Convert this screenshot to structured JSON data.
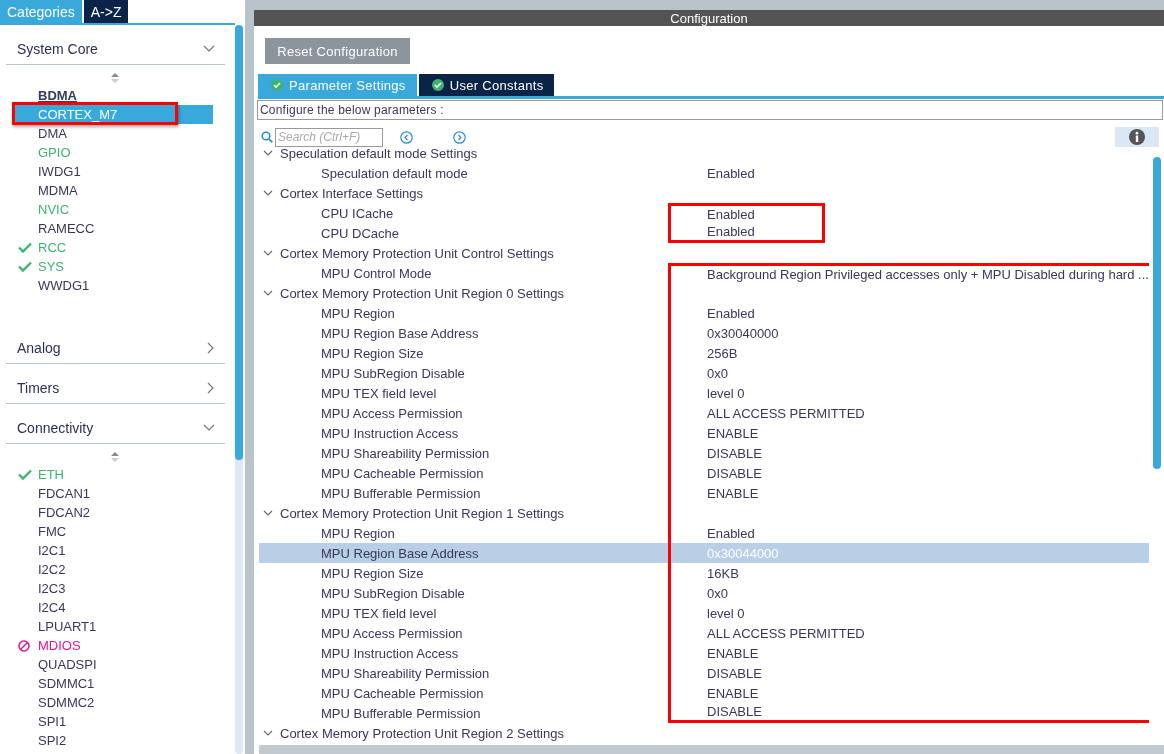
{
  "sidebar": {
    "tabs": [
      {
        "label": "Categories",
        "selected": true
      },
      {
        "label": "A->Z",
        "selected": false
      }
    ],
    "sections": [
      {
        "title": "System Core",
        "expanded": true,
        "items": [
          {
            "label": "BDMA",
            "kind": "emphasis",
            "selected": false,
            "marked": false
          },
          {
            "label": "CORTEX_M7",
            "kind": "plain",
            "selected": true,
            "marked": true
          },
          {
            "label": "DMA",
            "kind": "plain",
            "selected": false,
            "marked": false
          },
          {
            "label": "GPIO",
            "kind": "green",
            "selected": false,
            "marked": false
          },
          {
            "label": "IWDG1",
            "kind": "plain",
            "selected": false,
            "marked": false
          },
          {
            "label": "MDMA",
            "kind": "plain",
            "selected": false,
            "marked": false
          },
          {
            "label": "NVIC",
            "kind": "green",
            "selected": false,
            "marked": false
          },
          {
            "label": "RAMECC",
            "kind": "plain",
            "selected": false,
            "marked": false
          },
          {
            "label": "RCC",
            "kind": "checked",
            "selected": false,
            "marked": false
          },
          {
            "label": "SYS",
            "kind": "checked",
            "selected": false,
            "marked": false
          },
          {
            "label": "WWDG1",
            "kind": "plain",
            "selected": false,
            "marked": false
          }
        ]
      },
      {
        "title": "Analog",
        "expanded": false
      },
      {
        "title": "Timers",
        "expanded": false
      },
      {
        "title": "Connectivity",
        "expanded": true,
        "items": [
          {
            "label": "ETH",
            "kind": "checked",
            "selected": false,
            "marked": false
          },
          {
            "label": "FDCAN1",
            "kind": "plain",
            "selected": false,
            "marked": false
          },
          {
            "label": "FDCAN2",
            "kind": "plain",
            "selected": false,
            "marked": false
          },
          {
            "label": "FMC",
            "kind": "plain",
            "selected": false,
            "marked": false
          },
          {
            "label": "I2C1",
            "kind": "plain",
            "selected": false,
            "marked": false
          },
          {
            "label": "I2C2",
            "kind": "plain",
            "selected": false,
            "marked": false
          },
          {
            "label": "I2C3",
            "kind": "plain",
            "selected": false,
            "marked": false
          },
          {
            "label": "I2C4",
            "kind": "plain",
            "selected": false,
            "marked": false
          },
          {
            "label": "LPUART1",
            "kind": "plain",
            "selected": false,
            "marked": false
          },
          {
            "label": "MDIOS",
            "kind": "blocked",
            "selected": false,
            "marked": false
          },
          {
            "label": "QUADSPI",
            "kind": "plain",
            "selected": false,
            "marked": false
          },
          {
            "label": "SDMMC1",
            "kind": "plain",
            "selected": false,
            "marked": false
          },
          {
            "label": "SDMMC2",
            "kind": "plain",
            "selected": false,
            "marked": false
          },
          {
            "label": "SPI1",
            "kind": "plain",
            "selected": false,
            "marked": false
          },
          {
            "label": "SPI2",
            "kind": "plain",
            "selected": false,
            "marked": false
          }
        ]
      }
    ]
  },
  "config": {
    "title": "Configuration",
    "reset_button": "Reset Configuration",
    "tabs": [
      {
        "label": "Parameter Settings",
        "selected": true
      },
      {
        "label": "User Constants",
        "selected": false
      }
    ],
    "description": "Configure the below parameters :",
    "search": {
      "placeholder": "Search (Ctrl+F)"
    },
    "groups": [
      {
        "title": "Speculation default mode Settings",
        "expanded": true,
        "marked": false,
        "params": [
          {
            "name": "Speculation default mode",
            "value": "Enabled",
            "selected": false,
            "marked": false
          }
        ]
      },
      {
        "title": "Cortex Interface Settings",
        "expanded": true,
        "marked": false,
        "params": [
          {
            "name": "CPU ICache",
            "value": "Enabled",
            "selected": false,
            "marked": true
          },
          {
            "name": "CPU DCache",
            "value": "Enabled",
            "selected": false,
            "marked": true
          }
        ]
      },
      {
        "title": "Cortex Memory Protection Unit Control Settings",
        "expanded": true,
        "marked": false,
        "params": [
          {
            "name": "MPU Control Mode",
            "value": "Background Region Privileged accesses only + MPU Disabled during hard ...",
            "selected": false,
            "marked": true
          }
        ]
      },
      {
        "title": "Cortex Memory Protection Unit Region 0 Settings",
        "expanded": true,
        "marked": true,
        "params": [
          {
            "name": "MPU Region",
            "value": "Enabled",
            "selected": false,
            "marked": true
          },
          {
            "name": "MPU Region Base Address",
            "value": "0x30040000",
            "selected": false,
            "marked": true
          },
          {
            "name": "MPU Region Size",
            "value": "256B",
            "selected": false,
            "marked": true
          },
          {
            "name": "MPU SubRegion Disable",
            "value": "0x0",
            "selected": false,
            "marked": true
          },
          {
            "name": "MPU TEX field level",
            "value": "level 0",
            "selected": false,
            "marked": true
          },
          {
            "name": "MPU Access Permission",
            "value": "ALL ACCESS PERMITTED",
            "selected": false,
            "marked": true
          },
          {
            "name": "MPU Instruction Access",
            "value": "ENABLE",
            "selected": false,
            "marked": true
          },
          {
            "name": "MPU Shareability Permission",
            "value": "DISABLE",
            "selected": false,
            "marked": true
          },
          {
            "name": "MPU Cacheable Permission",
            "value": "DISABLE",
            "selected": false,
            "marked": true
          },
          {
            "name": "MPU Bufferable  Permission",
            "value": "ENABLE",
            "selected": false,
            "marked": true
          }
        ]
      },
      {
        "title": "Cortex Memory Protection Unit Region 1 Settings",
        "expanded": true,
        "marked": true,
        "params": [
          {
            "name": "MPU Region",
            "value": "Enabled",
            "selected": false,
            "marked": true
          },
          {
            "name": "MPU Region Base Address",
            "value": "0x30044000",
            "selected": true,
            "marked": true
          },
          {
            "name": "MPU Region Size",
            "value": "16KB",
            "selected": false,
            "marked": true
          },
          {
            "name": "MPU SubRegion Disable",
            "value": "0x0",
            "selected": false,
            "marked": true
          },
          {
            "name": "MPU TEX field level",
            "value": "level 0",
            "selected": false,
            "marked": true
          },
          {
            "name": "MPU Access Permission",
            "value": "ALL ACCESS PERMITTED",
            "selected": false,
            "marked": true
          },
          {
            "name": "MPU Instruction Access",
            "value": "ENABLE",
            "selected": false,
            "marked": true
          },
          {
            "name": "MPU Shareability Permission",
            "value": "DISABLE",
            "selected": false,
            "marked": true
          },
          {
            "name": "MPU Cacheable Permission",
            "value": "ENABLE",
            "selected": false,
            "marked": true
          },
          {
            "name": "MPU Bufferable  Permission",
            "value": "DISABLE",
            "selected": false,
            "marked": true
          }
        ]
      },
      {
        "title": "Cortex Memory Protection Unit Region 2 Settings",
        "expanded": true,
        "marked": false
      }
    ]
  }
}
